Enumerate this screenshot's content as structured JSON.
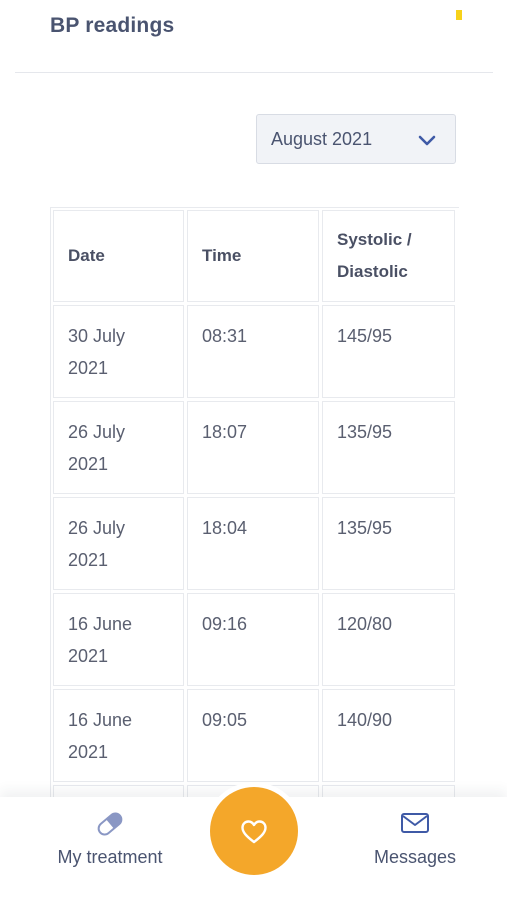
{
  "header": {
    "title": "BP readings"
  },
  "filter": {
    "selected_month": "August 2021",
    "icon": "chevron-down-icon"
  },
  "table": {
    "headers": {
      "date": "Date",
      "time": "Time",
      "bp_line1": "Systolic /",
      "bp_line2": "Diastolic"
    },
    "rows": [
      {
        "date_line1": "30 July",
        "date_line2": "2021",
        "time": "08:31",
        "bp": "145/95"
      },
      {
        "date_line1": "26 July",
        "date_line2": "2021",
        "time": "18:07",
        "bp": "135/95"
      },
      {
        "date_line1": "26 July",
        "date_line2": "2021",
        "time": "18:04",
        "bp": "135/95"
      },
      {
        "date_line1": "16 June",
        "date_line2": "2021",
        "time": "09:16",
        "bp": "120/80"
      },
      {
        "date_line1": "16 June",
        "date_line2": "2021",
        "time": "09:05",
        "bp": "140/90"
      }
    ]
  },
  "bottom_nav": {
    "treatment_label": "My treatment",
    "treatment_icon": "pill-icon",
    "center_icon": "heart-icon",
    "messages_label": "Messages",
    "messages_icon": "envelope-icon"
  },
  "colors": {
    "accent_orange": "#f4a72a",
    "text_navy": "#4a5470",
    "chevron_blue": "#3f5aa6",
    "marker_yellow": "#f7d21a"
  }
}
